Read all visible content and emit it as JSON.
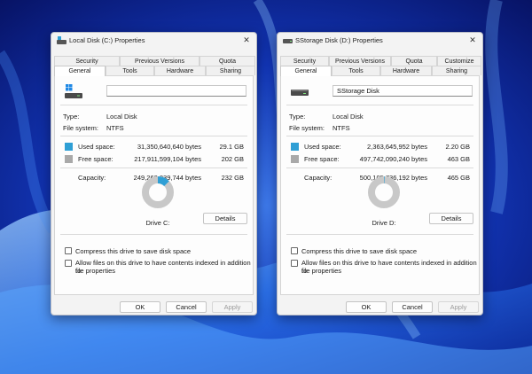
{
  "colors": {
    "used": "#2f9fd5",
    "free": "#a9a9a9",
    "accent": "#0067c0"
  },
  "common": {
    "tabs_row1": [
      "Security",
      "Previous Versions",
      "Quota"
    ],
    "tabs_row2": [
      "General",
      "Tools",
      "Hardware",
      "Sharing"
    ],
    "labels": {
      "type": "Type:",
      "file_system": "File system:",
      "used_space": "Used space:",
      "free_space": "Free space:",
      "capacity": "Capacity:",
      "details": "Details",
      "compress": "Compress this drive to save disk space",
      "index_line1": "Allow files on this drive to have contents indexed in addition to",
      "index_line2": "file properties",
      "ok": "OK",
      "cancel": "Cancel",
      "apply": "Apply"
    }
  },
  "dialog_c": {
    "title": "Local Disk (C:) Properties",
    "volume_name": "",
    "type": "Local Disk",
    "file_system": "NTFS",
    "used_bytes": "31,350,640,640 bytes",
    "used_gb": "29.1 GB",
    "free_bytes": "217,911,599,104 bytes",
    "free_gb": "202 GB",
    "capacity_bytes": "249,262,239,744 bytes",
    "capacity_gb": "232 GB",
    "used_fraction": 0.126,
    "drive_label": "Drive C:",
    "icon": "windows-drive-icon"
  },
  "dialog_d": {
    "title": "SStorage Disk (D:) Properties",
    "extra_tab": "Customize",
    "volume_name": "SStorage Disk",
    "type": "Local Disk",
    "file_system": "NTFS",
    "used_bytes": "2,363,645,952 bytes",
    "used_gb": "2.20 GB",
    "free_bytes": "497,742,090,240 bytes",
    "free_gb": "463 GB",
    "capacity_bytes": "500,105,736,192 bytes",
    "capacity_gb": "465 GB",
    "used_fraction": 0.005,
    "drive_label": "Drive D:",
    "icon": "hard-drive-icon"
  }
}
